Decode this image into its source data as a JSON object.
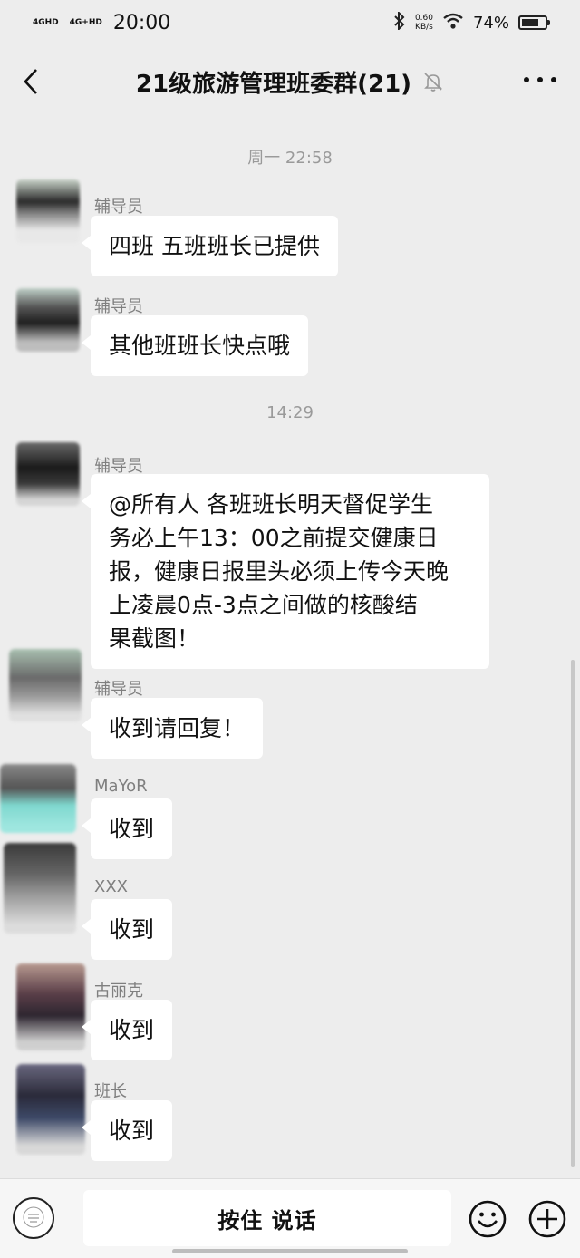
{
  "status_bar": {
    "network1": "4GHD",
    "network2": "4G+HD",
    "time": "20:00",
    "speed_value": "0.60",
    "speed_unit": "KB/s",
    "battery": "74%",
    "battery_level": 0.74
  },
  "header": {
    "title": "21级旅游管理班委群(21)",
    "back_icon": "chevron-left-icon",
    "mute_icon": "bell-off-icon",
    "more_icon": "more-dots-icon"
  },
  "chat": {
    "time_separators": [
      "周一 22:58",
      "14:29"
    ],
    "messages": [
      {
        "sender": "辅导员",
        "lines": [
          "四班  五班班长已提供"
        ]
      },
      {
        "sender": "辅导员",
        "lines": [
          "其他班班长快点哦"
        ]
      },
      {
        "sender": "辅导员",
        "lines": [
          "@所有人  各班班长明天督促学生",
          "务必上午13：00之前提交健康日",
          "报，健康日报里头必须上传今天晚",
          "上凌晨0点-3点之间做的核酸结",
          "果截图！"
        ]
      },
      {
        "sender": "辅导员",
        "lines": [
          "收到请回复！"
        ]
      },
      {
        "sender": "MaYoR",
        "lines": [
          "收到"
        ]
      },
      {
        "sender": "XXX",
        "lines": [
          "收到"
        ]
      },
      {
        "sender": "古丽克",
        "lines": [
          "收到"
        ]
      },
      {
        "sender": "班长",
        "lines": [
          "收到"
        ]
      }
    ]
  },
  "input_bar": {
    "hold_to_talk": "按住 说话",
    "voice_icon": "voice-avatar-icon",
    "emoji_icon": "emoji-icon",
    "plus_icon": "plus-icon"
  }
}
